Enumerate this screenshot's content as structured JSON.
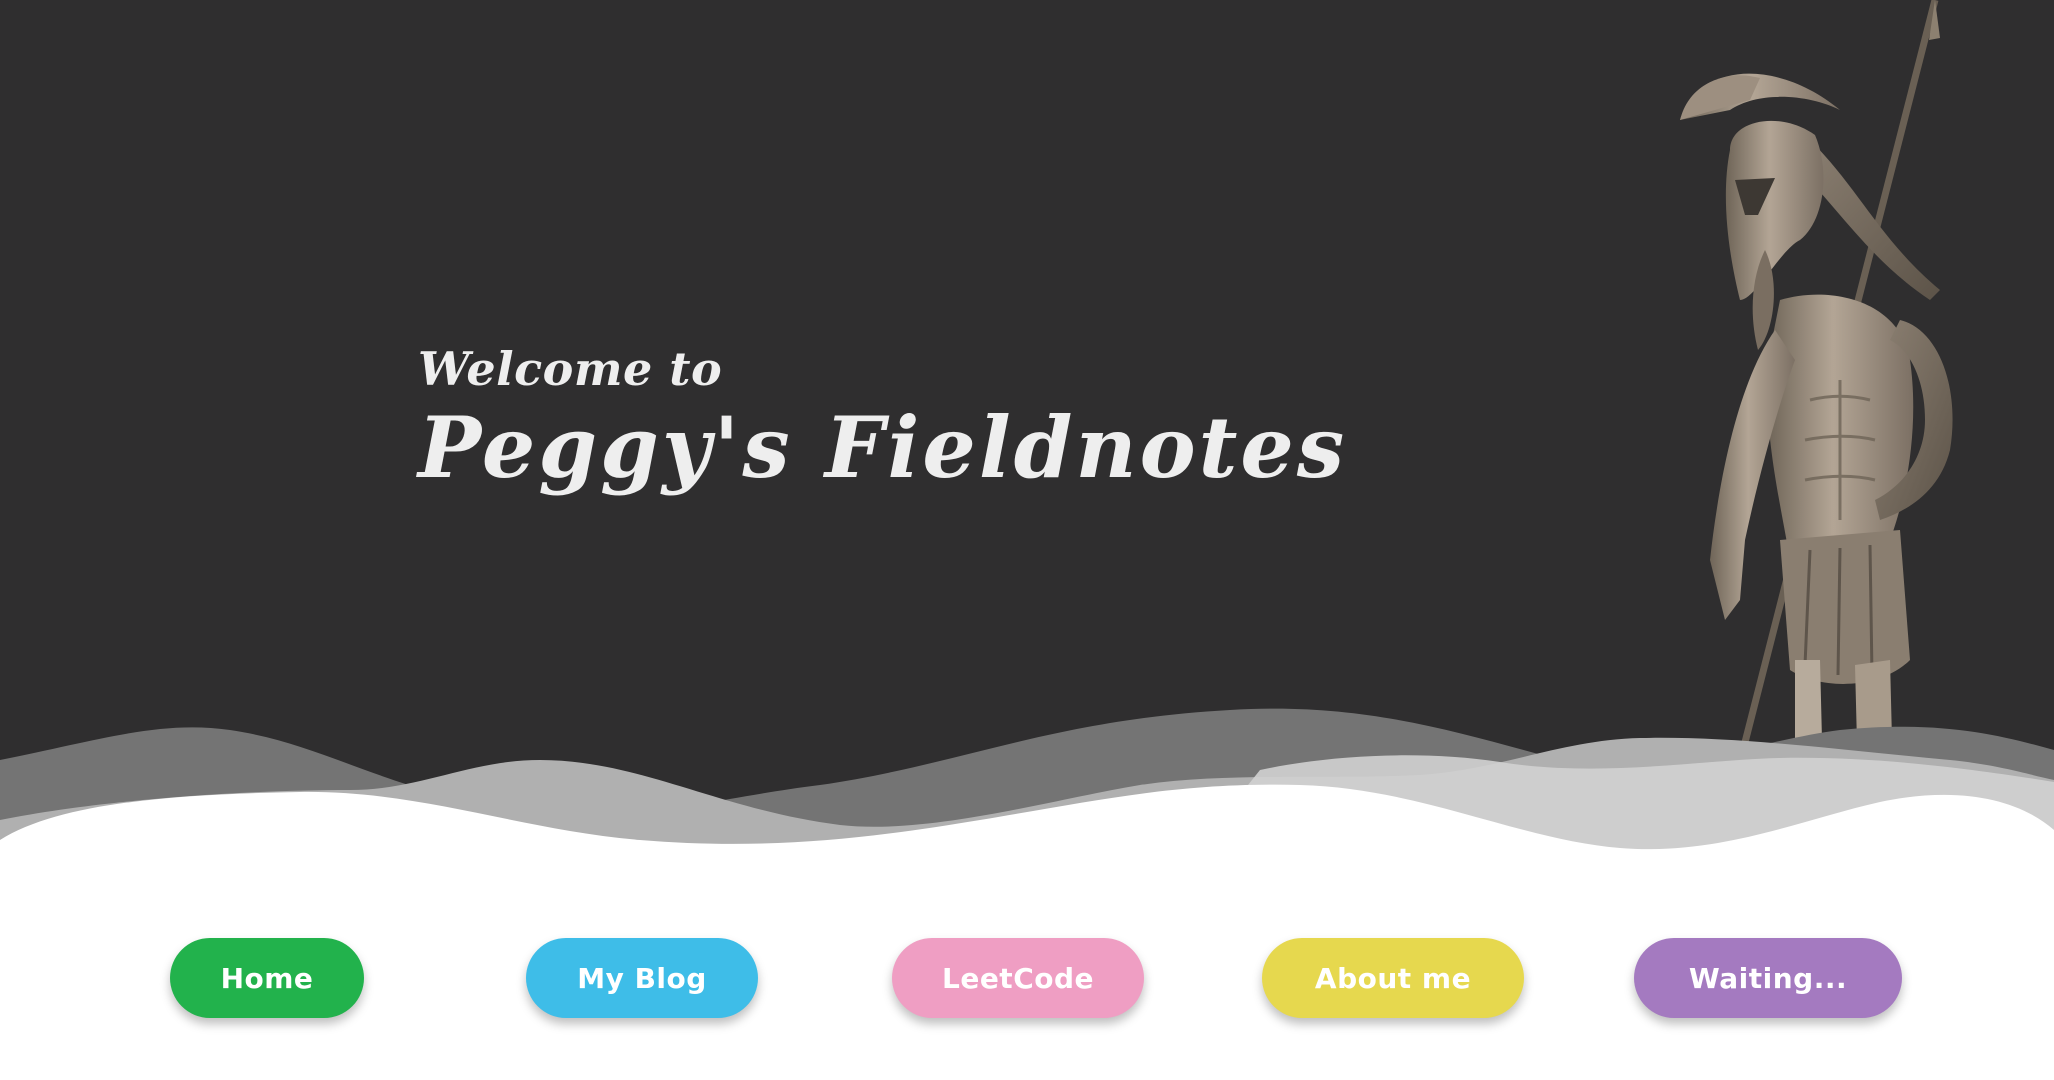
{
  "hero": {
    "welcome": "Welcome to",
    "title": "Peggy's Fieldnotes",
    "background_color": "#2f2e2f",
    "image": "spartan-warrior-statue"
  },
  "nav": {
    "buttons": [
      {
        "label": "Home",
        "color": "#22b24c"
      },
      {
        "label": "My Blog",
        "color": "#3ebde8"
      },
      {
        "label": "LeetCode",
        "color": "#ef9ec3"
      },
      {
        "label": "About me",
        "color": "#e6d84e"
      },
      {
        "label": "Waiting...",
        "color": "#a47ac0"
      }
    ]
  }
}
